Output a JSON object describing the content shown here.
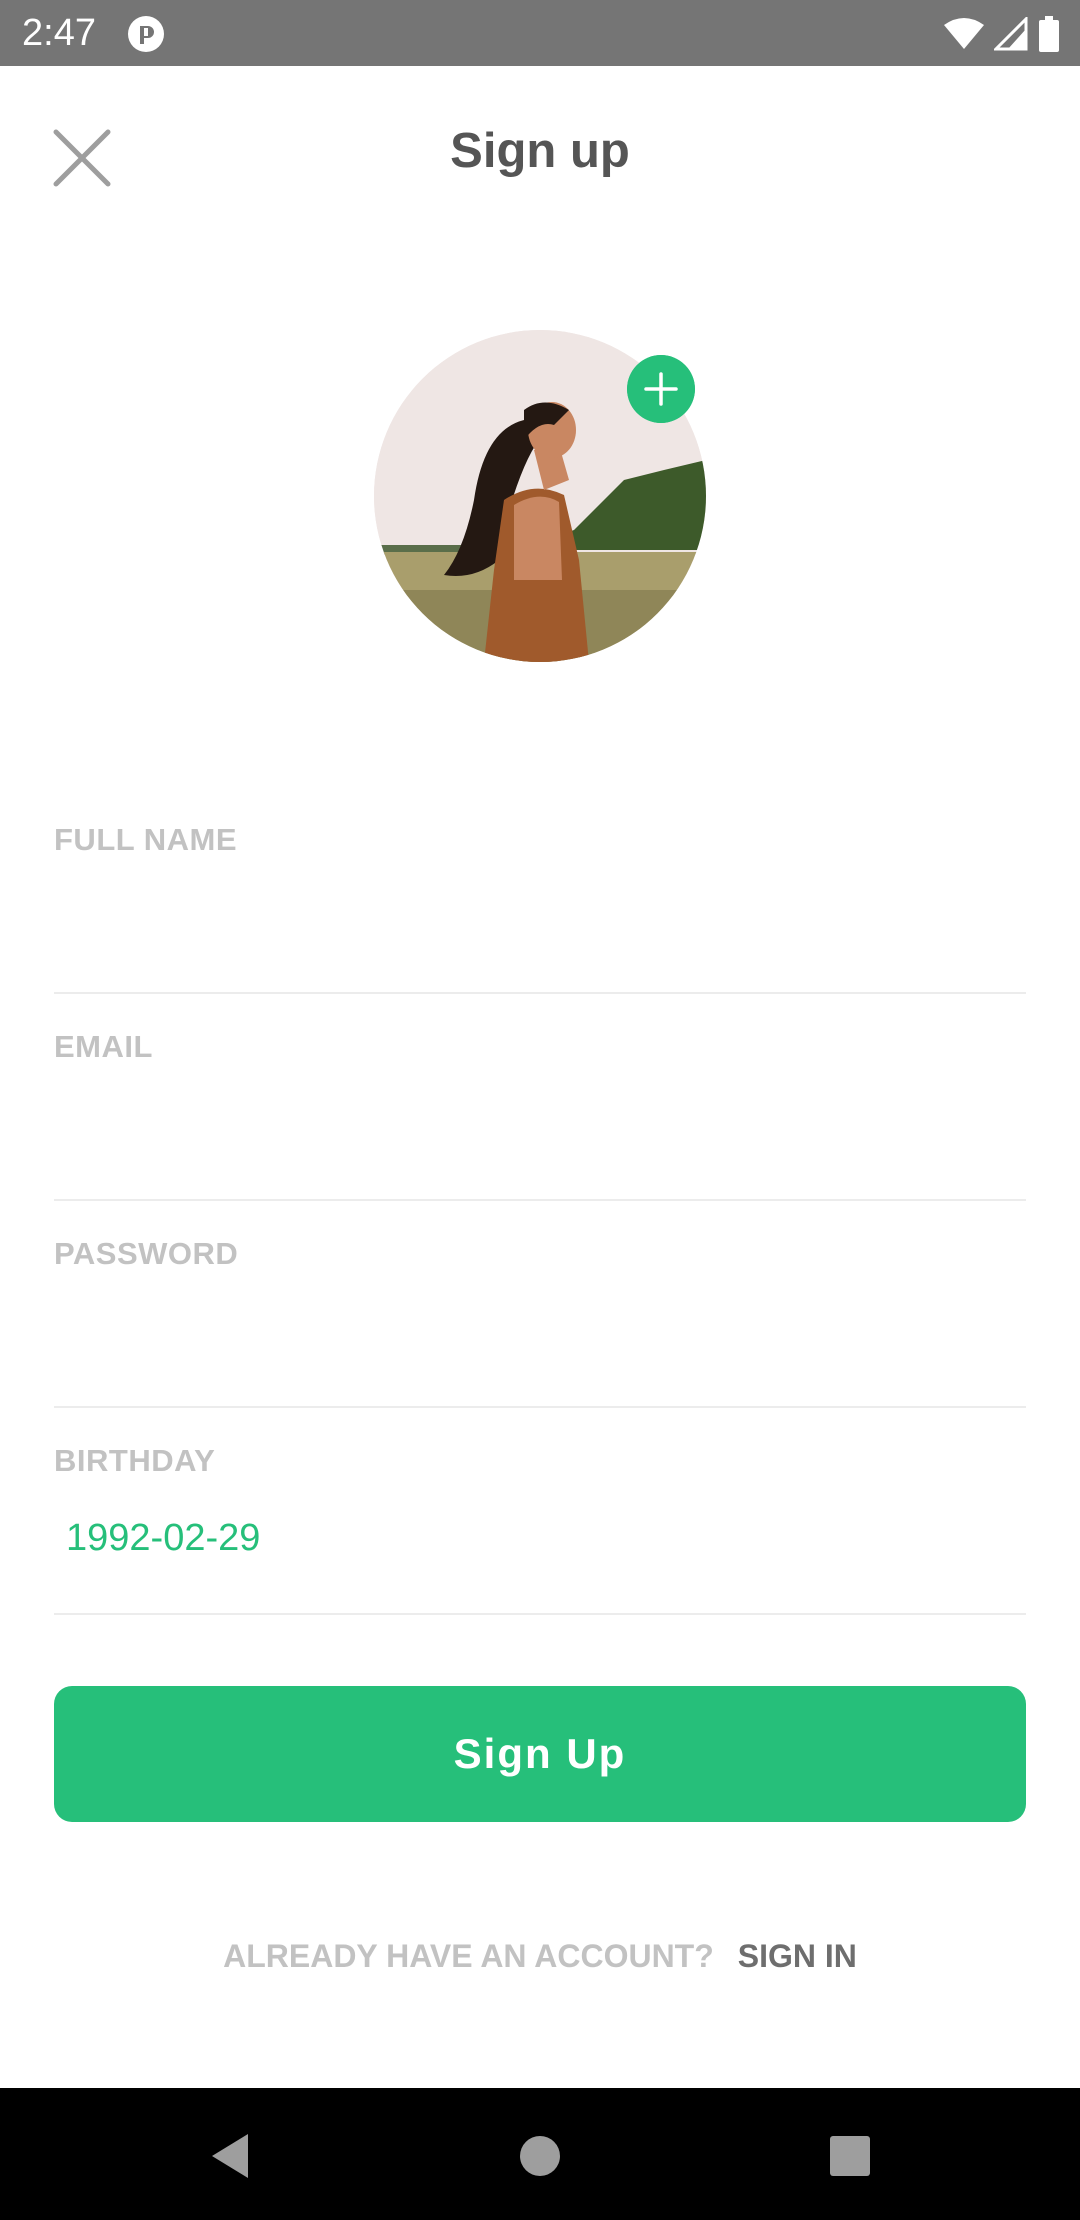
{
  "status_bar": {
    "time": "2:47"
  },
  "header": {
    "title": "Sign up",
    "close_icon": "close-icon"
  },
  "avatar": {
    "add_icon": "plus-icon"
  },
  "form": {
    "fields": [
      {
        "label": "FULL NAME",
        "value": "",
        "placeholder": ""
      },
      {
        "label": "EMAIL",
        "value": "",
        "placeholder": ""
      },
      {
        "label": "PASSWORD",
        "value": "",
        "placeholder": ""
      },
      {
        "label": "BIRTHDAY",
        "value": "1992-02-29",
        "placeholder": ""
      }
    ]
  },
  "actions": {
    "signup_label": "Sign Up",
    "already_prompt": "ALREADY HAVE AN ACCOUNT?",
    "signin_label": "SIGN IN"
  },
  "colors": {
    "accent": "#26bf7a",
    "status_bar": "#757575",
    "label_gray": "#c2c2c2",
    "title_gray": "#555555"
  },
  "nav_bar": {
    "icons": [
      "back-icon",
      "home-icon",
      "recents-icon"
    ]
  }
}
